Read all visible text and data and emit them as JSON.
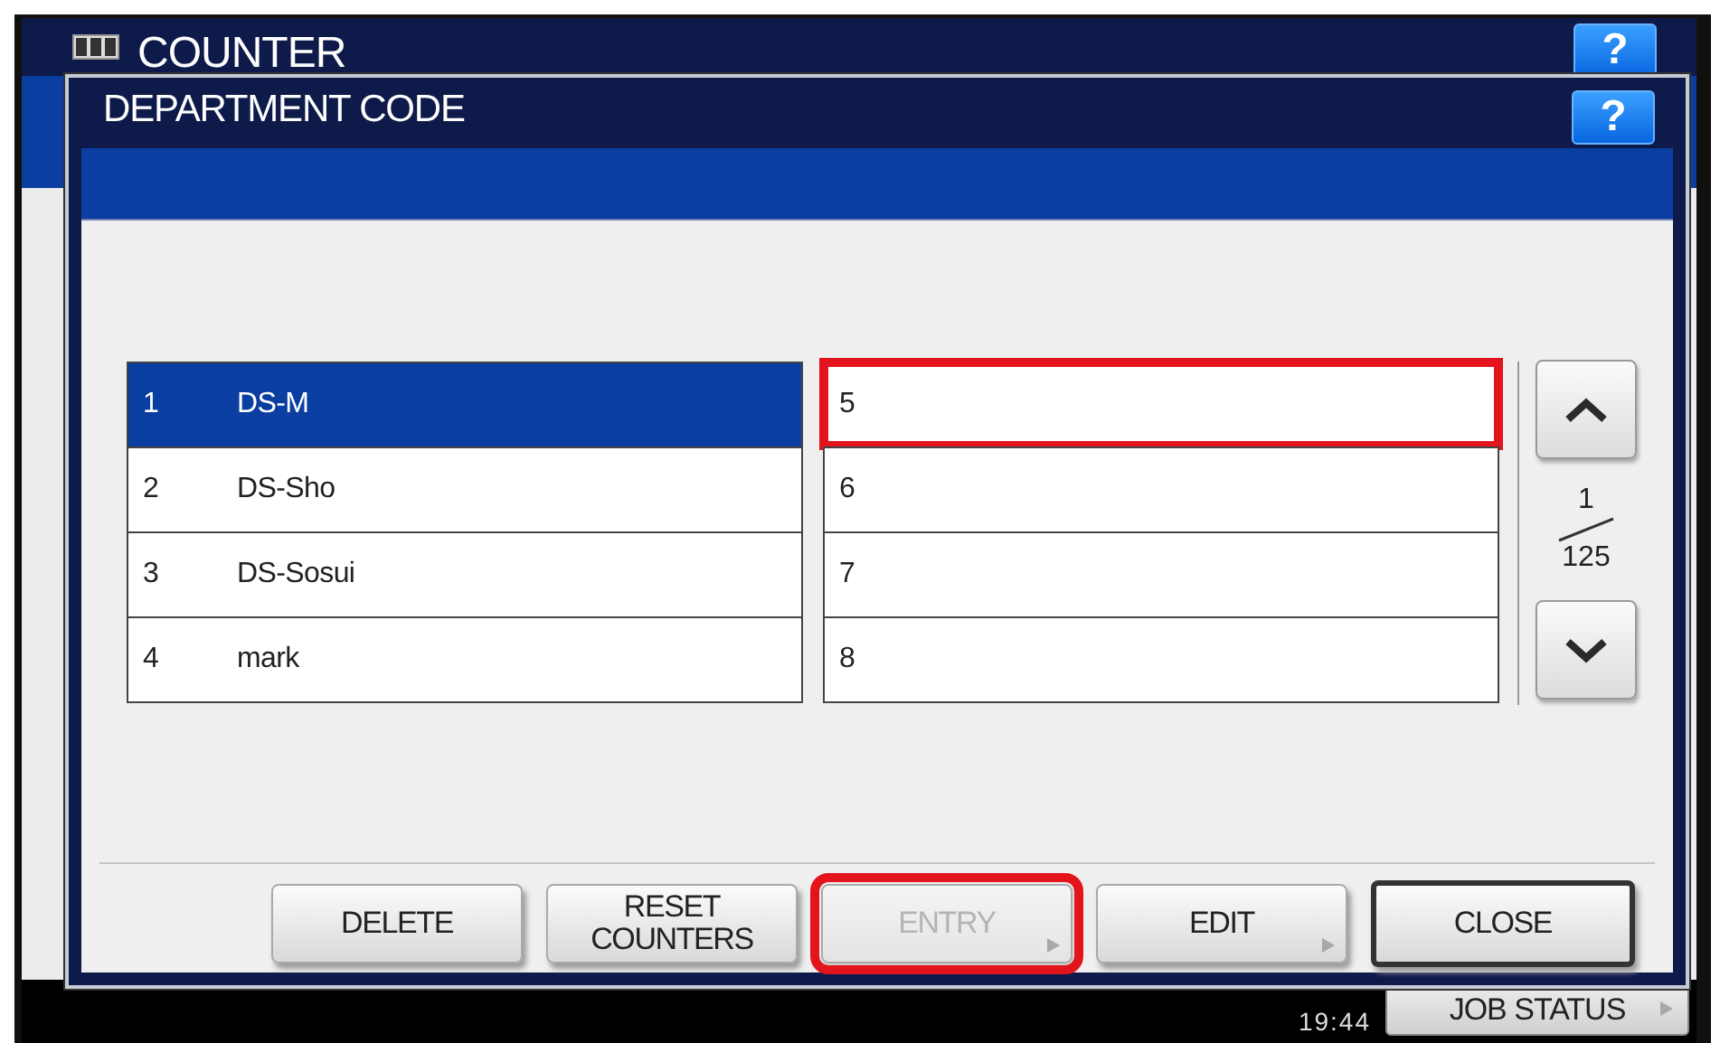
{
  "background": {
    "title": "COUNTER",
    "help": "?",
    "time": "19:44",
    "job_status": "JOB STATUS"
  },
  "dialog": {
    "title": "DEPARTMENT CODE",
    "help": "?",
    "entries": [
      {
        "number": "1",
        "name": "DS-M",
        "selected": true,
        "highlighted": false
      },
      {
        "number": "2",
        "name": "DS-Sho",
        "selected": false,
        "highlighted": false
      },
      {
        "number": "3",
        "name": "DS-Sosui",
        "selected": false,
        "highlighted": false
      },
      {
        "number": "4",
        "name": "mark",
        "selected": false,
        "highlighted": false
      },
      {
        "number": "5",
        "selected": false,
        "highlighted": true
      },
      {
        "number": "6",
        "selected": false,
        "highlighted": false
      },
      {
        "number": "7",
        "selected": false,
        "highlighted": false
      },
      {
        "number": "8",
        "selected": false,
        "highlighted": false
      }
    ],
    "page": {
      "current": "1",
      "total": "125"
    },
    "buttons": [
      {
        "label": "DELETE",
        "kind": "normal",
        "disabled": false,
        "highlighted": false,
        "arrow": false
      },
      {
        "label": "RESET\nCOUNTERS",
        "kind": "normal",
        "disabled": false,
        "highlighted": false,
        "arrow": false
      },
      {
        "label": "ENTRY",
        "kind": "normal",
        "disabled": true,
        "highlighted": true,
        "arrow": true
      },
      {
        "label": "EDIT",
        "kind": "normal",
        "disabled": false,
        "highlighted": false,
        "arrow": true
      },
      {
        "label": "CLOSE",
        "kind": "default",
        "disabled": false,
        "highlighted": false,
        "arrow": false
      }
    ]
  }
}
